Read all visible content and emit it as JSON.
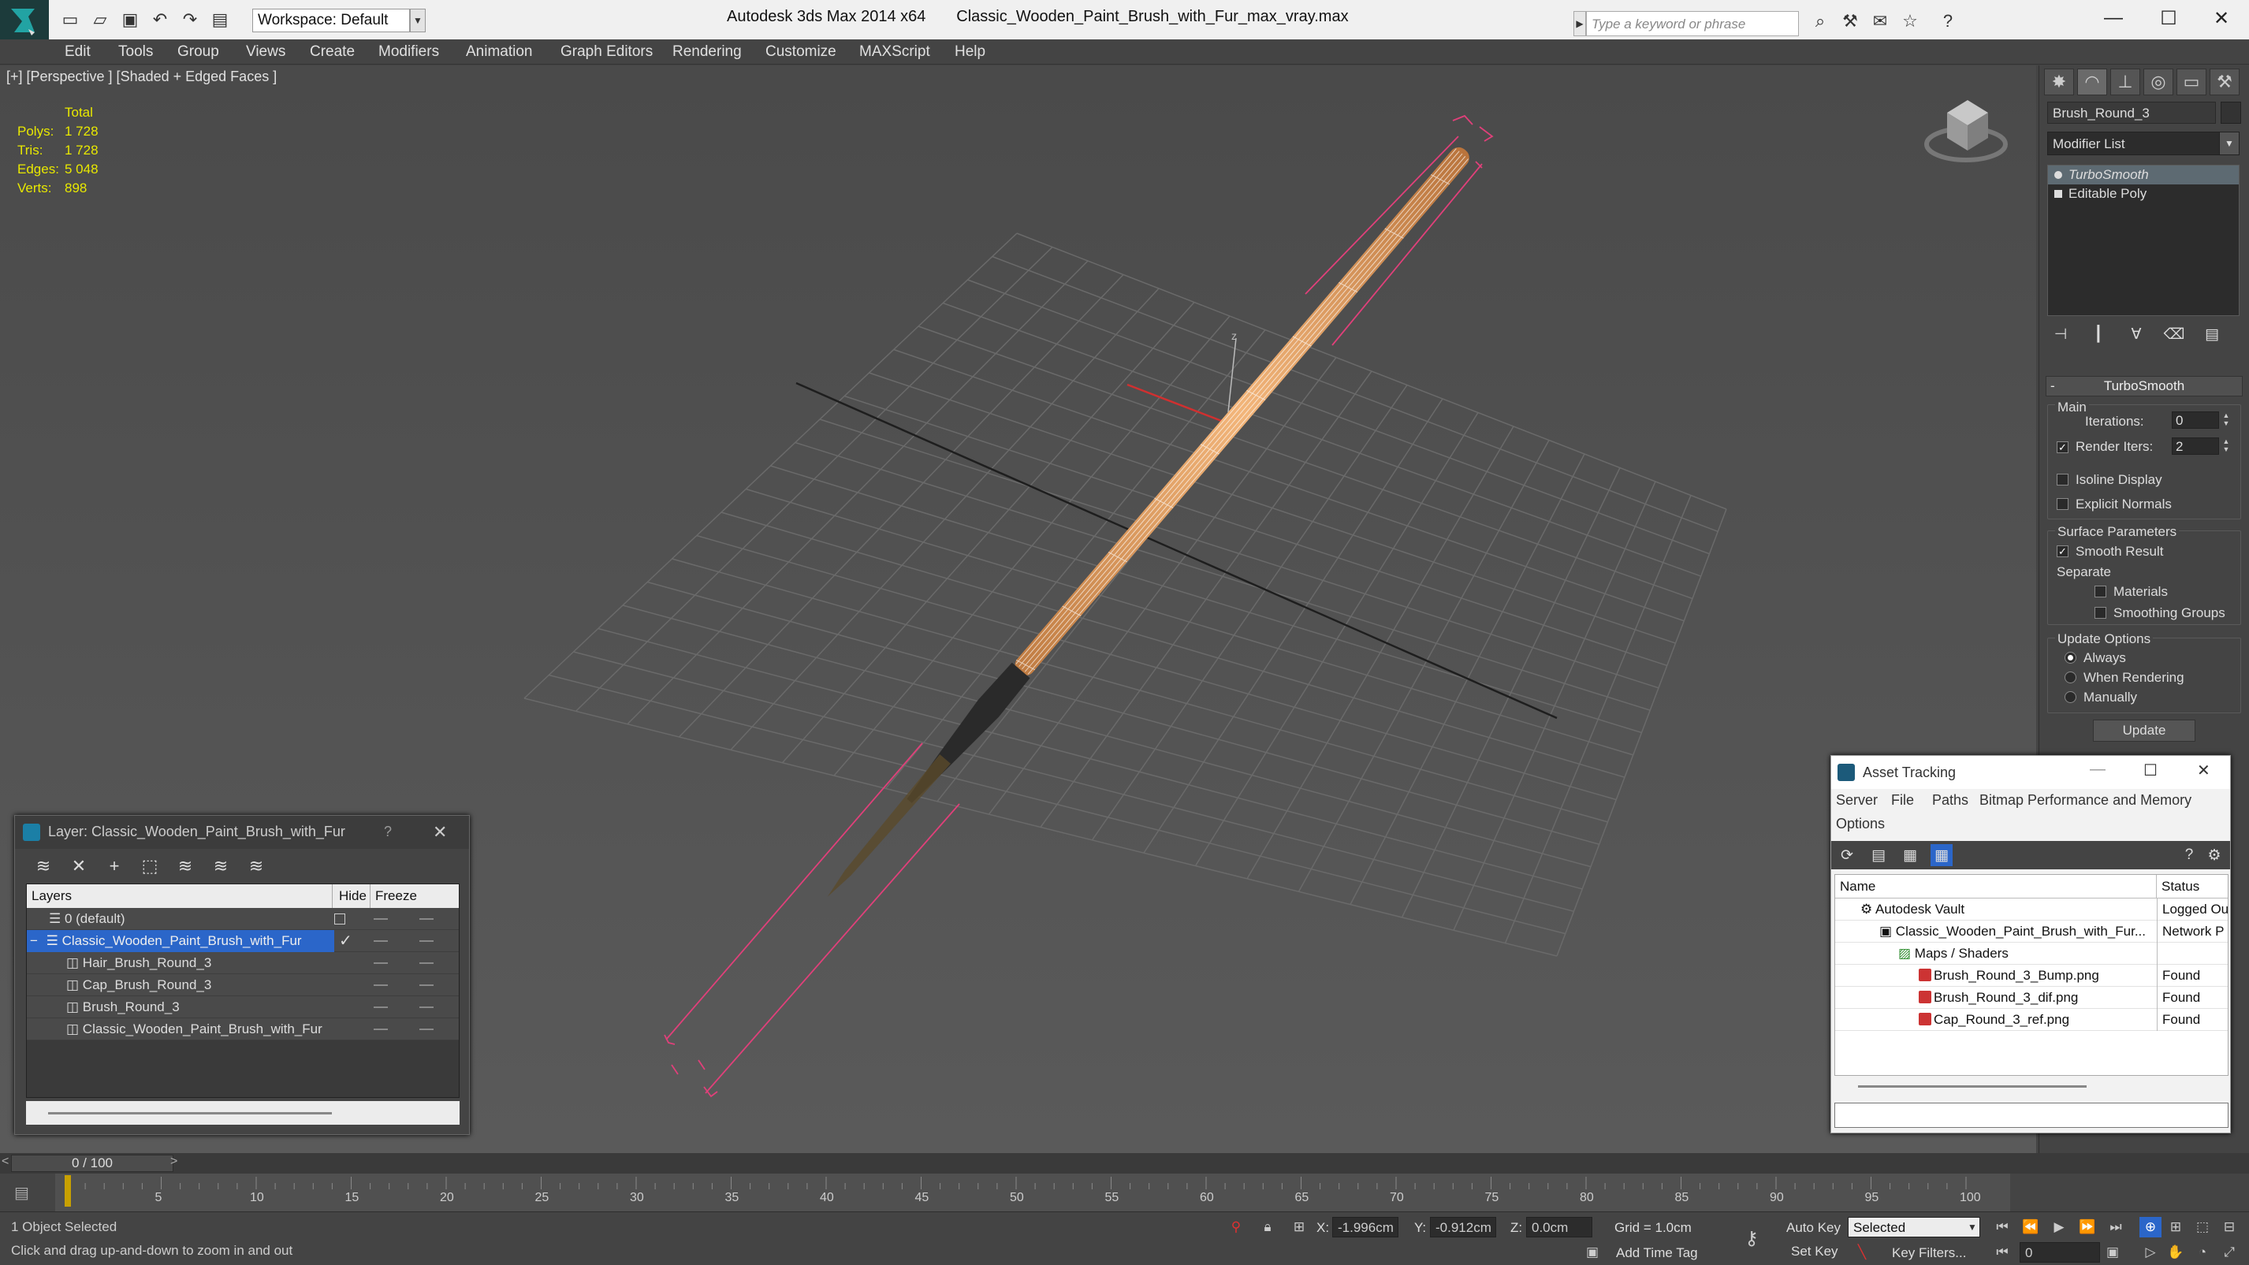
{
  "app": {
    "title": "Autodesk 3ds Max  2014 x64",
    "file": "Classic_Wooden_Paint_Brush_with_Fur_max_vray.max",
    "workspace": "Workspace: Default",
    "search_placeholder": "Type a keyword or phrase"
  },
  "menu": [
    "Edit",
    "Tools",
    "Group",
    "Views",
    "Create",
    "Modifiers",
    "Animation",
    "Graph Editors",
    "Rendering",
    "Customize",
    "MAXScript",
    "Help"
  ],
  "viewport": {
    "label": "[+] [Perspective ] [Shaded + Edged Faces ]",
    "stats_title": "Total",
    "stats": [
      {
        "label": "Polys:",
        "value": "1 728"
      },
      {
        "label": "Tris:",
        "value": "1 728"
      },
      {
        "label": "Edges:",
        "value": "5 048"
      },
      {
        "label": "Verts:",
        "value": "898"
      }
    ],
    "axis_label": "z"
  },
  "command_panel": {
    "object_name": "Brush_Round_3",
    "modifier_list": "Modifier List",
    "stack": [
      "TurboSmooth",
      "Editable Poly"
    ],
    "turbosmooth": {
      "title": "TurboSmooth",
      "main": "Main",
      "iterations_label": "Iterations:",
      "iterations": "0",
      "render_iters_label": "Render Iters:",
      "render_iters": "2",
      "isoline": "Isoline Display",
      "explicit_normals": "Explicit Normals",
      "surface_params": "Surface Parameters",
      "smooth_result": "Smooth Result",
      "separate": "Separate",
      "materials": "Materials",
      "smoothing_groups": "Smoothing Groups",
      "update_options": "Update Options",
      "always": "Always",
      "when_rendering": "When Rendering",
      "manually": "Manually",
      "update": "Update"
    }
  },
  "layer_dialog": {
    "title": "Layer: Classic_Wooden_Paint_Brush_with_Fur",
    "help": "?",
    "col_layers": "Layers",
    "col_hide": "Hide",
    "col_freeze": "Freeze",
    "rows": [
      {
        "name": "0 (default)",
        "indent": 0
      },
      {
        "name": "Classic_Wooden_Paint_Brush_with_Fur",
        "indent": 0
      },
      {
        "name": "Hair_Brush_Round_3",
        "indent": 1
      },
      {
        "name": "Cap_Brush_Round_3",
        "indent": 1
      },
      {
        "name": "Brush_Round_3",
        "indent": 1
      },
      {
        "name": "Classic_Wooden_Paint_Brush_with_Fur",
        "indent": 1
      }
    ]
  },
  "asset_tracking": {
    "title": "Asset Tracking",
    "menu": [
      "Server",
      "File",
      "Paths",
      "Bitmap Performance and Memory",
      "Options"
    ],
    "col_name": "Name",
    "col_status": "Status",
    "rows": [
      {
        "name": "Autodesk Vault",
        "status": "Logged Ou",
        "indent": 1
      },
      {
        "name": "Classic_Wooden_Paint_Brush_with_Fur...",
        "status": "Network P",
        "indent": 2
      },
      {
        "name": "Maps / Shaders",
        "status": "",
        "indent": 3
      },
      {
        "name": "Brush_Round_3_Bump.png",
        "status": "Found",
        "indent": 4
      },
      {
        "name": "Brush_Round_3_dif.png",
        "status": "Found",
        "indent": 4
      },
      {
        "name": "Cap_Round_3_ref.png",
        "status": "Found",
        "indent": 4
      }
    ]
  },
  "timeline": {
    "frame": "0 / 100",
    "ticks": [
      "5",
      "10",
      "15",
      "20",
      "25",
      "30",
      "35",
      "40",
      "45",
      "50",
      "55",
      "60",
      "65",
      "70",
      "75",
      "80",
      "85",
      "90",
      "95",
      "100"
    ]
  },
  "status_bar": {
    "selection": "1 Object Selected",
    "prompt": "Click and drag up-and-down to zoom in and out",
    "x_label": "X:",
    "x": "-1.996cm",
    "y_label": "Y:",
    "y": "-0.912cm",
    "z_label": "Z:",
    "z": "0.0cm",
    "grid": "Grid = 1.0cm",
    "add_time_tag": "Add Time Tag",
    "auto_key": "Auto Key",
    "set_key": "Set Key",
    "selected": "Selected",
    "key_filters": "Key Filters...",
    "frame_field": "0"
  },
  "colors": {
    "selection_blue": "#2b66c9",
    "stats_yellow": "#e8e800",
    "brush_wood": "#e5a468",
    "bbox_pink": "#e0407a"
  }
}
